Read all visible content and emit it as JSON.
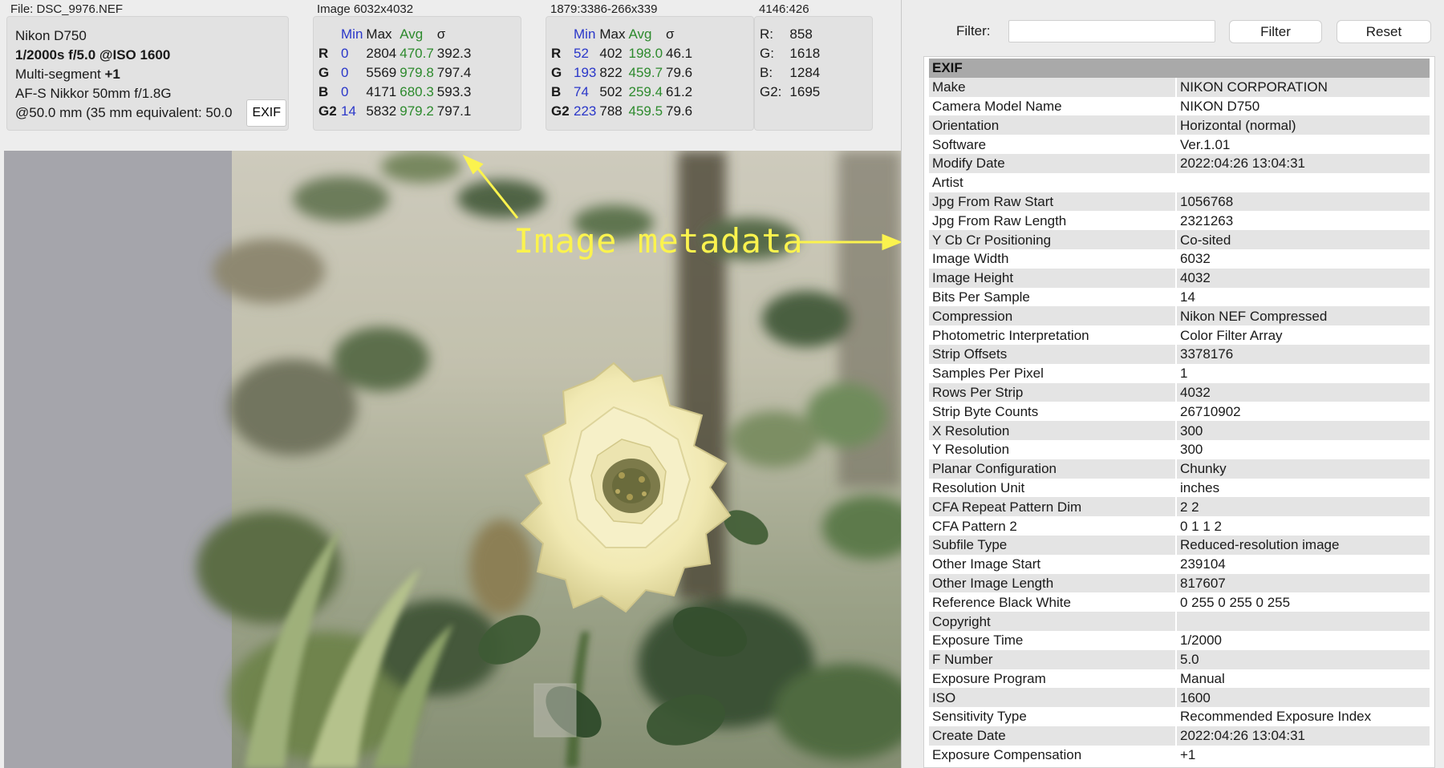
{
  "info_bar": {
    "file_label": "File: DSC_9976.NEF",
    "image_label": "Image 6032x4032",
    "region_label": "1879:3386-266x339",
    "pixel_label": "4146:426"
  },
  "camera": {
    "model": "Nikon D750",
    "exposure_line": "1/2000s f/5.0 @ISO 1600",
    "metering_text": "Multi-segment ",
    "metering_comp": "+1",
    "lens": "AF-S Nikkor 50mm f/1.8G",
    "focal": "@50.0 mm (35 mm equivalent: 50.0",
    "exif_button": "EXIF"
  },
  "stats_headers": {
    "min": "Min",
    "max": "Max",
    "avg": "Avg",
    "std": "σ"
  },
  "image_stats": [
    {
      "ch": "R",
      "min": "0",
      "max": "2804",
      "avg": "470.7",
      "std": "392.3"
    },
    {
      "ch": "G",
      "min": "0",
      "max": "5569",
      "avg": "979.8",
      "std": "797.4"
    },
    {
      "ch": "B",
      "min": "0",
      "max": "4171",
      "avg": "680.3",
      "std": "593.3"
    },
    {
      "ch": "G2",
      "min": "14",
      "max": "5832",
      "avg": "979.2",
      "std": "797.1"
    }
  ],
  "region_stats": [
    {
      "ch": "R",
      "min": "52",
      "max": "402",
      "avg": "198.0",
      "std": "46.1"
    },
    {
      "ch": "G",
      "min": "193",
      "max": "822",
      "avg": "459.7",
      "std": "79.6"
    },
    {
      "ch": "B",
      "min": "74",
      "max": "502",
      "avg": "259.4",
      "std": "61.2"
    },
    {
      "ch": "G2",
      "min": "223",
      "max": "788",
      "avg": "459.5",
      "std": "79.6"
    }
  ],
  "pixel_values": [
    {
      "ch": "R:",
      "val": "858"
    },
    {
      "ch": "G:",
      "val": "1618"
    },
    {
      "ch": "B:",
      "val": "1284"
    },
    {
      "ch": "G2:",
      "val": "1695"
    }
  ],
  "annotation": {
    "text": "Image metadata",
    "color": "#fbf34e"
  },
  "exif_panel": {
    "filter_label": "Filter:",
    "filter_value": "",
    "filter_button": "Filter",
    "reset_button": "Reset",
    "section": "EXIF",
    "rows": [
      {
        "key": "Make",
        "value": "NIKON CORPORATION"
      },
      {
        "key": "Camera Model Name",
        "value": "NIKON D750"
      },
      {
        "key": "Orientation",
        "value": "Horizontal (normal)"
      },
      {
        "key": "Software",
        "value": "Ver.1.01"
      },
      {
        "key": "Modify Date",
        "value": "2022:04:26 13:04:31"
      },
      {
        "key": "Artist",
        "value": ""
      },
      {
        "key": "Jpg From Raw Start",
        "value": "1056768"
      },
      {
        "key": "Jpg From Raw Length",
        "value": "2321263"
      },
      {
        "key": "Y Cb Cr Positioning",
        "value": "Co-sited"
      },
      {
        "key": "Image Width",
        "value": "6032"
      },
      {
        "key": "Image Height",
        "value": "4032"
      },
      {
        "key": "Bits Per Sample",
        "value": "14"
      },
      {
        "key": "Compression",
        "value": "Nikon NEF Compressed"
      },
      {
        "key": "Photometric Interpretation",
        "value": "Color Filter Array"
      },
      {
        "key": "Strip Offsets",
        "value": "3378176"
      },
      {
        "key": "Samples Per Pixel",
        "value": "1"
      },
      {
        "key": "Rows Per Strip",
        "value": "4032"
      },
      {
        "key": "Strip Byte Counts",
        "value": "26710902"
      },
      {
        "key": "X Resolution",
        "value": "300"
      },
      {
        "key": "Y Resolution",
        "value": "300"
      },
      {
        "key": "Planar Configuration",
        "value": "Chunky"
      },
      {
        "key": "Resolution Unit",
        "value": "inches"
      },
      {
        "key": "CFA Repeat Pattern Dim",
        "value": "2 2"
      },
      {
        "key": "CFA Pattern 2",
        "value": "0 1 1 2"
      },
      {
        "key": "Subfile Type",
        "value": "Reduced-resolution image"
      },
      {
        "key": "Other Image Start",
        "value": "239104"
      },
      {
        "key": "Other Image Length",
        "value": "817607"
      },
      {
        "key": "Reference Black White",
        "value": "0 255 0 255 0 255"
      },
      {
        "key": "Copyright",
        "value": ""
      },
      {
        "key": "Exposure Time",
        "value": "1/2000"
      },
      {
        "key": "F Number",
        "value": "5.0"
      },
      {
        "key": "Exposure Program",
        "value": "Manual"
      },
      {
        "key": "ISO",
        "value": "1600"
      },
      {
        "key": "Sensitivity Type",
        "value": "Recommended Exposure Index"
      },
      {
        "key": "Create Date",
        "value": "2022:04:26 13:04:31"
      },
      {
        "key": "Exposure Compensation",
        "value": "+1"
      }
    ]
  }
}
